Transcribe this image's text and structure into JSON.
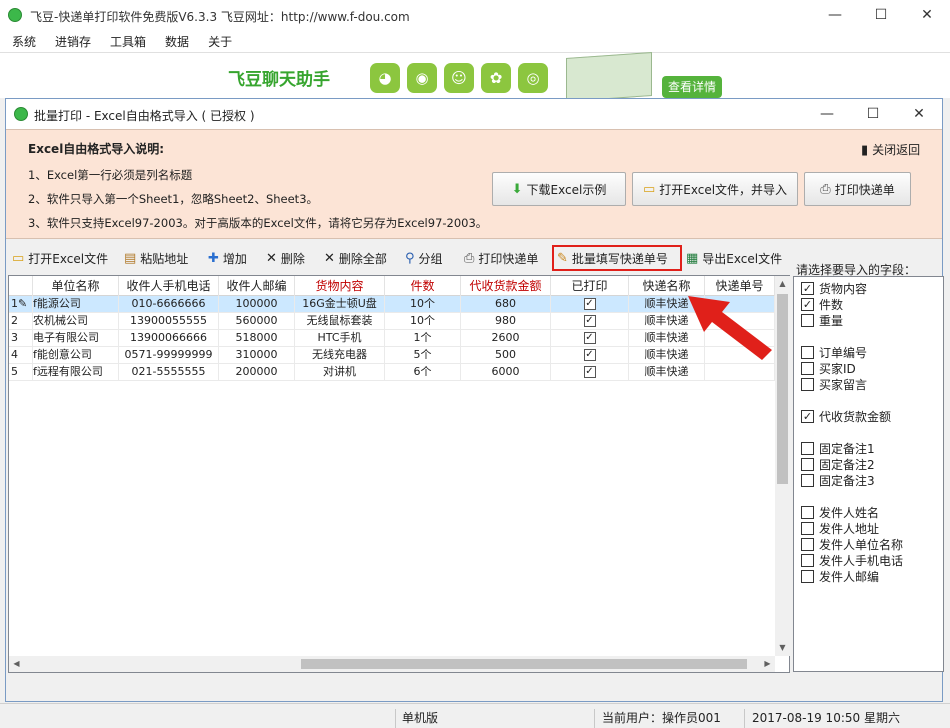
{
  "app": {
    "title": "飞豆-快递单打印软件免费版V6.3.3  飞豆网址：http://www.f-dou.com",
    "menu": [
      "系统",
      "进销存",
      "工具箱",
      "数据",
      "关于"
    ],
    "banner_title": "飞豆聊天助手",
    "detail_button": "查看详情"
  },
  "dialog": {
    "title": "批量打印 - Excel自由格式导入 ( 已授权 )",
    "info_heading": "Excel自由格式导入说明:",
    "info_lines": [
      "1、Excel第一行必须是列名标题",
      "2、软件只导入第一个Sheet1，忽略Sheet2、Sheet3。",
      "3、软件只支持Excel97-2003。对于高版本的Excel文件，请将它另存为Excel97-2003。"
    ],
    "close_return": "关闭返回",
    "buttons": {
      "download_sample": "下载Excel示例",
      "open_import": "打开Excel文件，并导入",
      "print_waybill": "打印快递单"
    }
  },
  "toolbar": {
    "open_excel": "打开Excel文件",
    "paste_address": "粘贴地址",
    "add": "增加",
    "delete": "删除",
    "delete_all": "删除全部",
    "group": "分组",
    "print_waybill": "打印快递单",
    "batch_fill": "批量填写快递单号",
    "export_excel": "导出Excel文件"
  },
  "grid": {
    "columns": [
      "单位名称",
      "收件人手机电话",
      "收件人邮编",
      "货物内容",
      "件数",
      "代收货款金额",
      "已打印",
      "快递名称",
      "快递单号"
    ],
    "rows": [
      {
        "num": "1",
        "company": "f能源公司",
        "phone": "010-6666666",
        "zip": "100000",
        "goods": "16G金士顿U盘",
        "qty": "10个",
        "cod": "680",
        "printed": true,
        "courier": "顺丰快递",
        "waybill": ""
      },
      {
        "num": "2",
        "company": "农机械公司",
        "phone": "13900055555",
        "zip": "560000",
        "goods": "无线鼠标套装",
        "qty": "10个",
        "cod": "980",
        "printed": true,
        "courier": "顺丰快递",
        "waybill": ""
      },
      {
        "num": "3",
        "company": "电子有限公司",
        "phone": "13900066666",
        "zip": "518000",
        "goods": "HTC手机",
        "qty": "1个",
        "cod": "2600",
        "printed": true,
        "courier": "顺丰快递",
        "waybill": ""
      },
      {
        "num": "4",
        "company": "f能创意公司",
        "phone": "0571-99999999",
        "zip": "310000",
        "goods": "无线充电器",
        "qty": "5个",
        "cod": "500",
        "printed": true,
        "courier": "顺丰快递",
        "waybill": ""
      },
      {
        "num": "5",
        "company": "f远程有限公司",
        "phone": "021-5555555",
        "zip": "200000",
        "goods": "对讲机",
        "qty": "6个",
        "cod": "6000",
        "printed": true,
        "courier": "顺丰快递",
        "waybill": ""
      }
    ]
  },
  "fields": {
    "label": "请选择要导入的字段：",
    "items": [
      {
        "label": "货物内容",
        "checked": true
      },
      {
        "label": "件数",
        "checked": true
      },
      {
        "label": "重量",
        "checked": false
      },
      {
        "label": "订单编号",
        "checked": false
      },
      {
        "label": "买家ID",
        "checked": false
      },
      {
        "label": "买家留言",
        "checked": false
      },
      {
        "label": "代收货款金额",
        "checked": true
      },
      {
        "label": "固定备注1",
        "checked": false
      },
      {
        "label": "固定备注2",
        "checked": false
      },
      {
        "label": "固定备注3",
        "checked": false
      },
      {
        "label": "发件人姓名",
        "checked": false
      },
      {
        "label": "发件人地址",
        "checked": false
      },
      {
        "label": "发件人单位名称",
        "checked": false
      },
      {
        "label": "发件人手机电话",
        "checked": false
      },
      {
        "label": "发件人邮编",
        "checked": false
      }
    ]
  },
  "status": {
    "mode": "单机版",
    "user": "当前用户：操作员001",
    "datetime": "2017-08-19 10:50 星期六"
  },
  "colors": {
    "accent_red": "#e0201a",
    "header_red": "#c00000",
    "info_bg": "#fce4d6",
    "brand_green": "#37a52f"
  }
}
